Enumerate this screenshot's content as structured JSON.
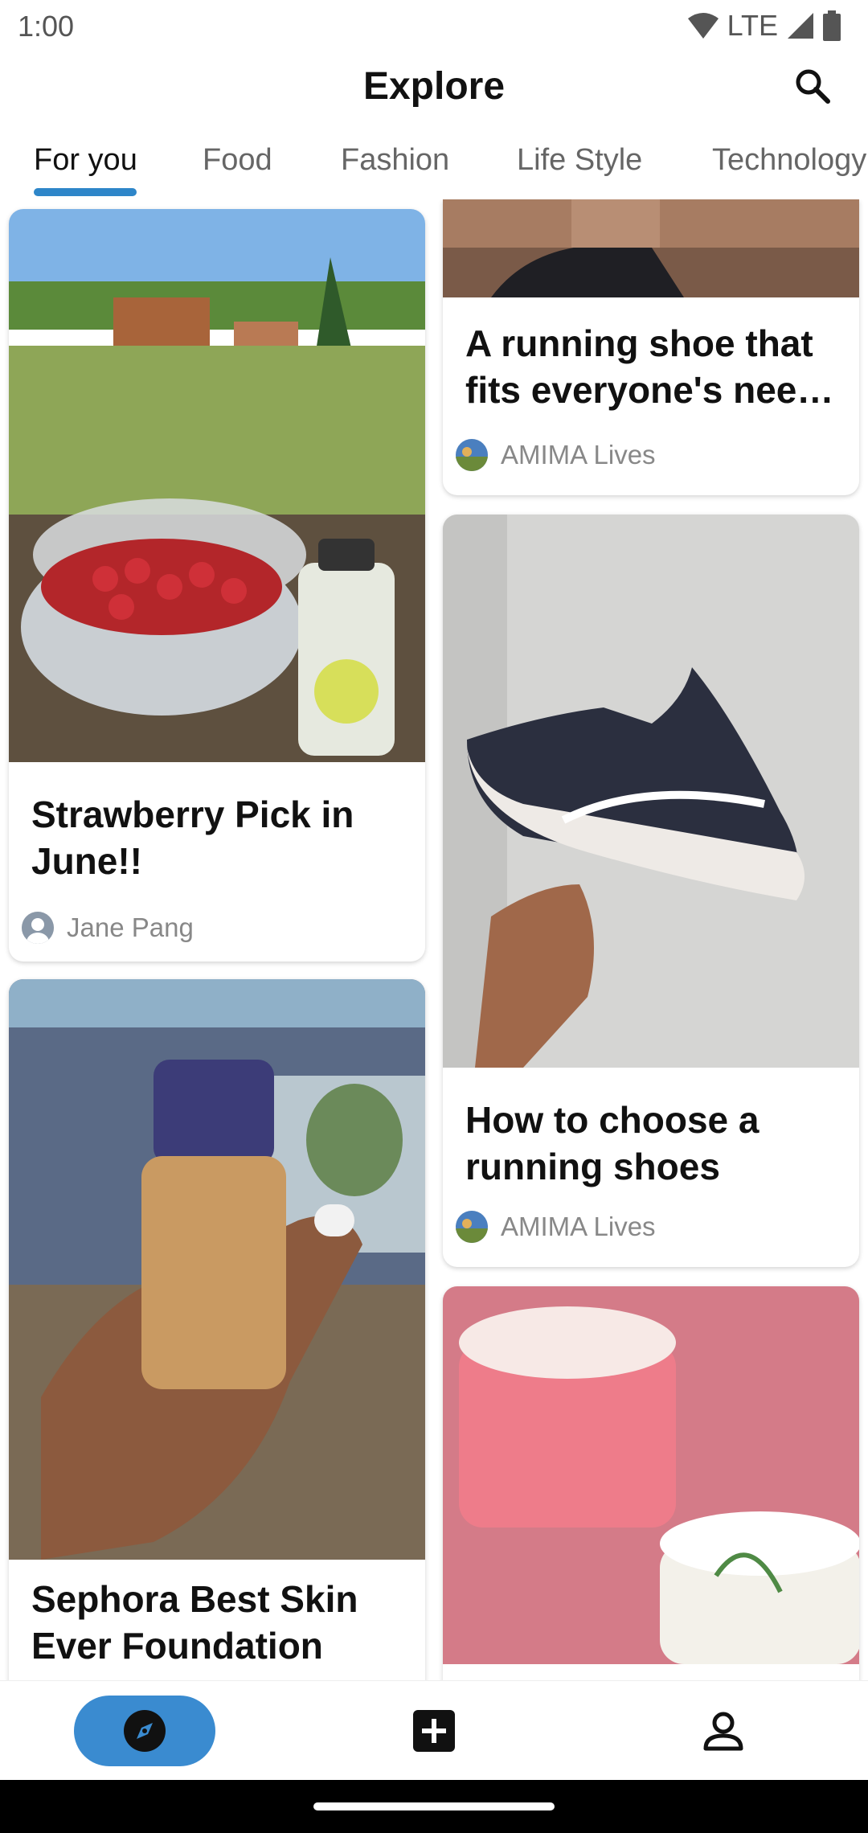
{
  "status_bar": {
    "time": "1:00",
    "network": "LTE"
  },
  "header": {
    "title": "Explore",
    "search_icon": "search-icon"
  },
  "tabs": [
    {
      "label": "For you",
      "active": true
    },
    {
      "label": "Food",
      "active": false
    },
    {
      "label": "Fashion",
      "active": false
    },
    {
      "label": "Life Style",
      "active": false
    },
    {
      "label": "Technology",
      "active": false
    }
  ],
  "feed": {
    "left_column": [
      {
        "title": "Strawberry Pick in June!!",
        "author": "Jane Pang",
        "image": "strawberries-picnic-photo"
      },
      {
        "title": "Sephora Best Skin Ever Foundation",
        "author": "",
        "image": "foundation-bottle-photo"
      }
    ],
    "right_column": [
      {
        "title": "A running shoe that fits everyone's nee…",
        "author": "AMIMA Lives",
        "image": "shoe-photo-partial"
      },
      {
        "title": "How to choose a running shoes",
        "author": "AMIMA Lives",
        "image": "running-shoe-photo"
      },
      {
        "title": "",
        "author": "",
        "image": "battle-of-the-balms-photo"
      }
    ]
  },
  "bottom_nav": {
    "items": [
      {
        "icon": "compass-icon",
        "active": true
      },
      {
        "icon": "add-post-icon",
        "active": false
      },
      {
        "icon": "profile-icon",
        "active": false
      }
    ]
  },
  "colors": {
    "accent": "#2e86c9",
    "nav_active_bg": "#3a8bd0",
    "author_text": "#888888"
  }
}
